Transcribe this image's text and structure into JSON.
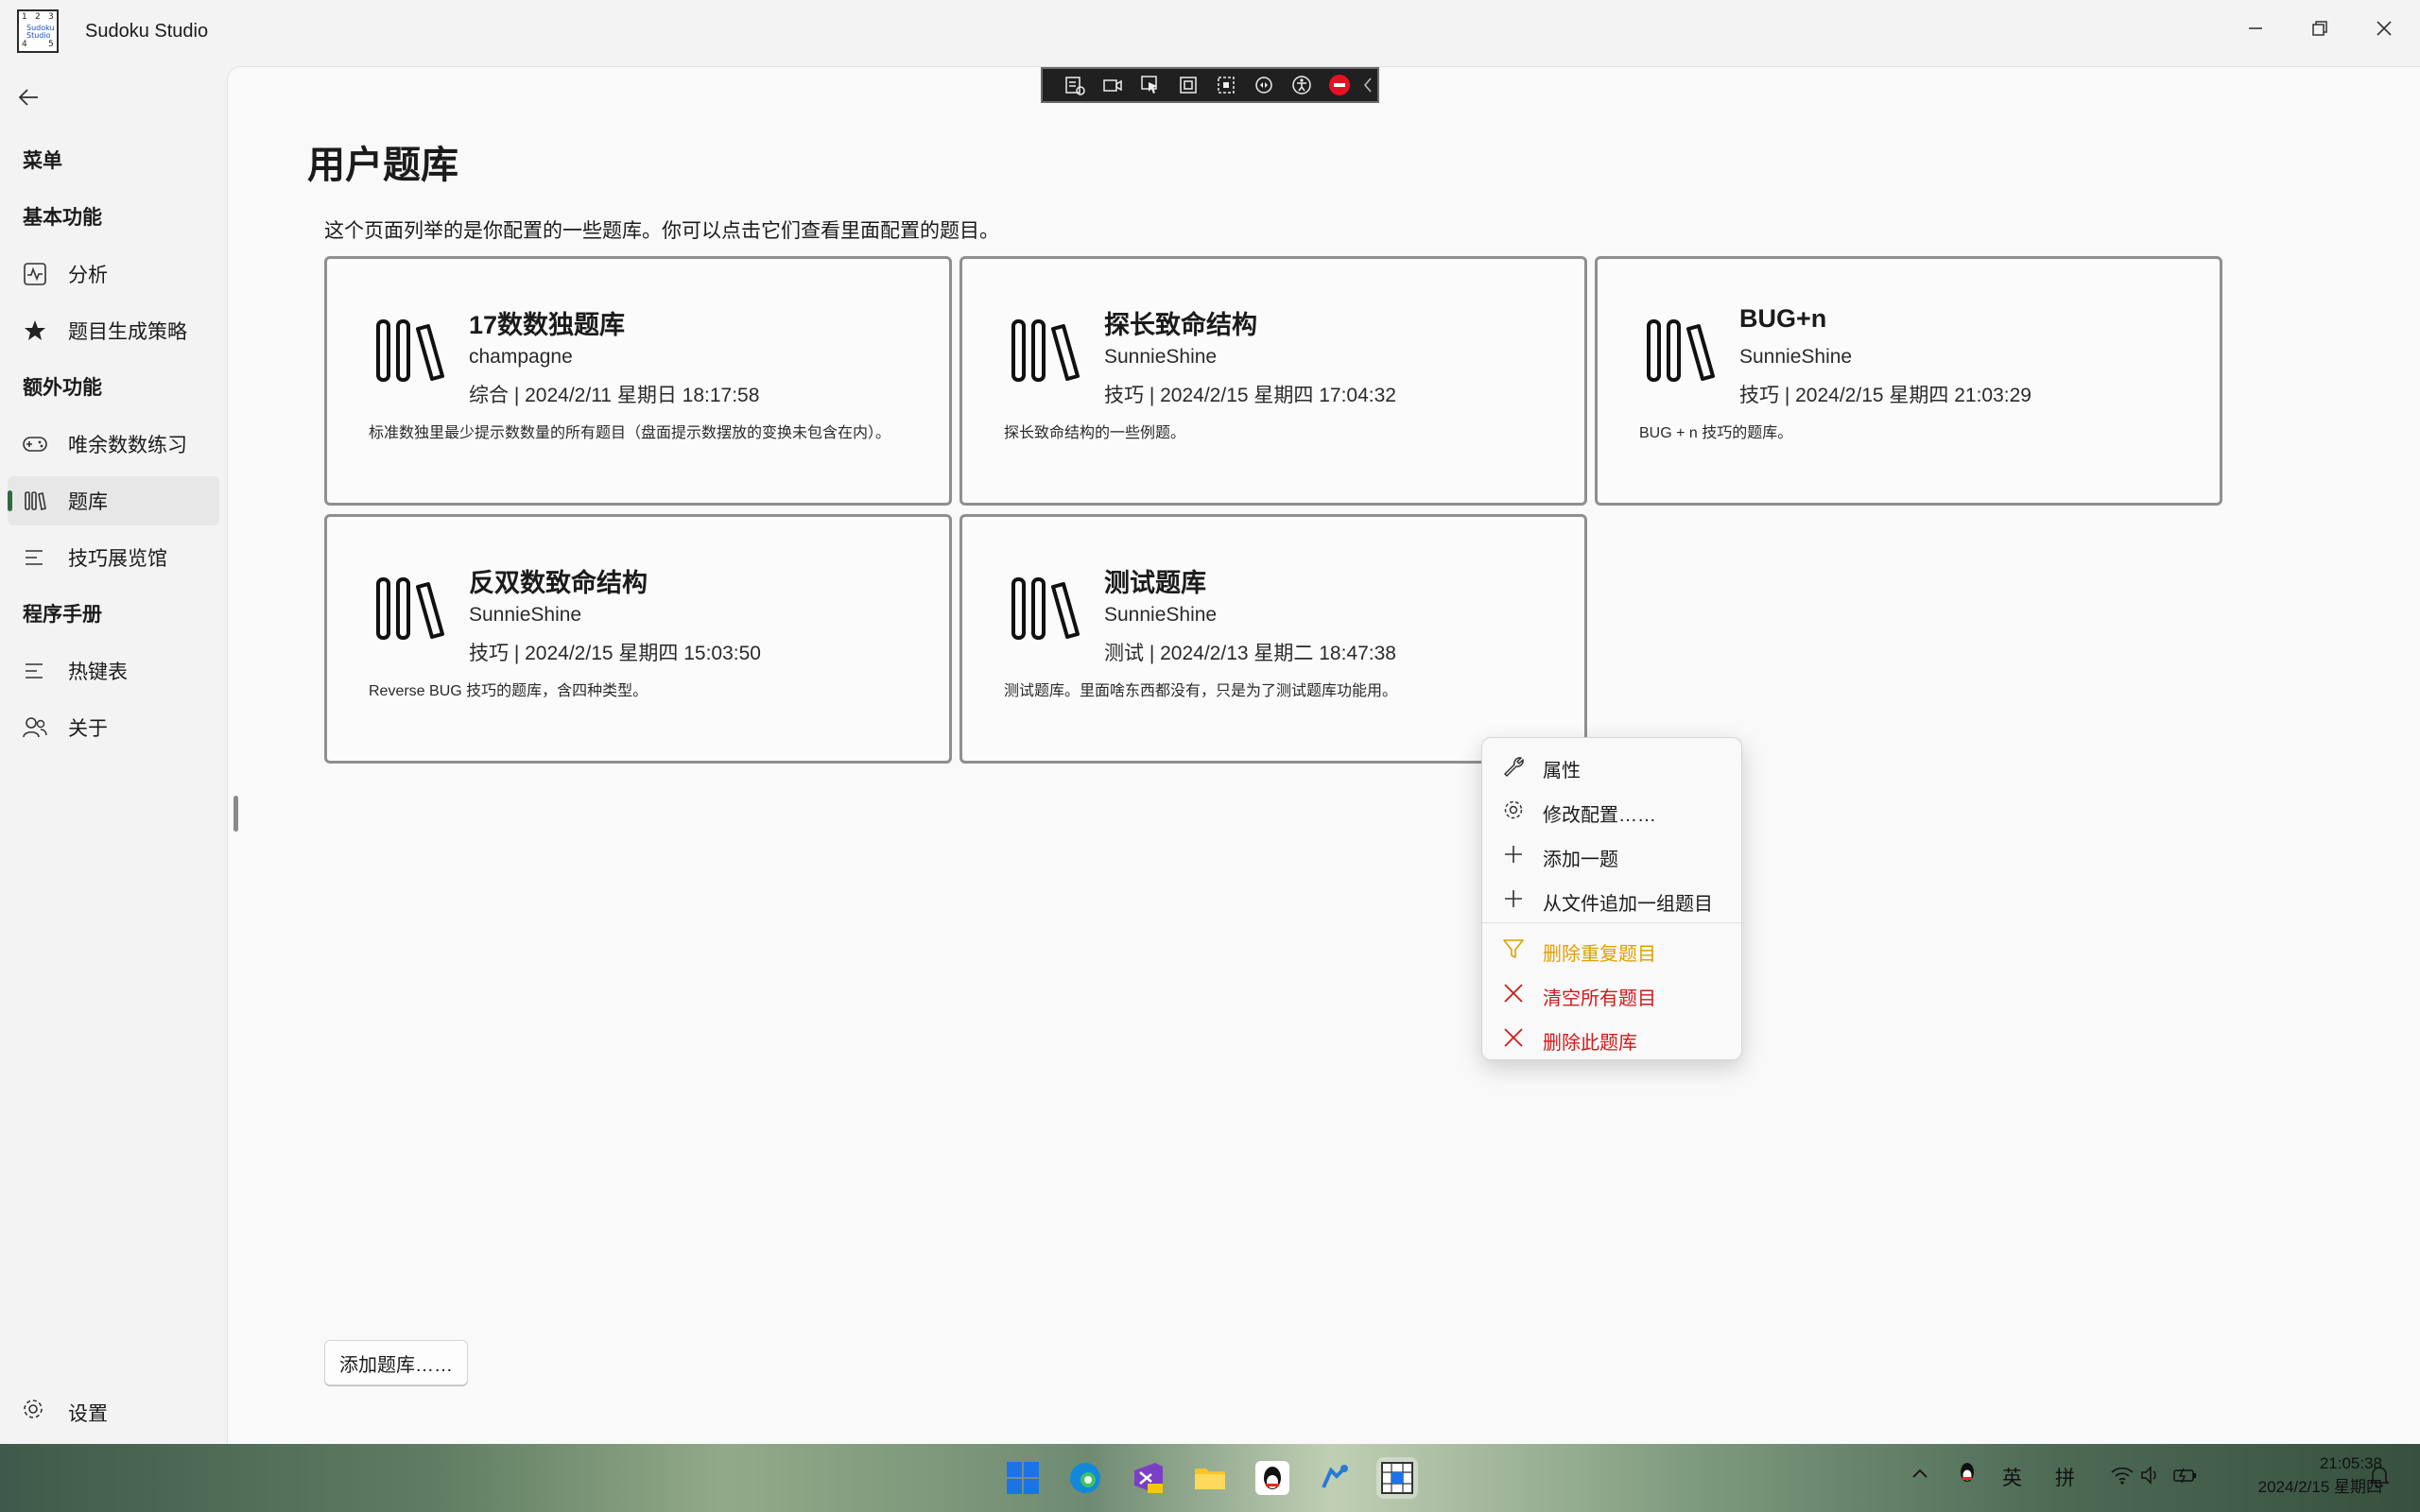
{
  "app": {
    "title": "Sudoku Studio",
    "icon_digits": [
      "1",
      "2",
      "3",
      "4",
      "5"
    ],
    "icon_text": "Sudoku Studio"
  },
  "window_controls": {
    "minimize": "—",
    "restore": "❐",
    "close": "✕"
  },
  "sidebar": {
    "menu_header": "菜单",
    "groups": {
      "basic": "基本功能",
      "extra": "额外功能",
      "manual": "程序手册"
    },
    "items": {
      "analysis": "分析",
      "strategy": "题目生成策略",
      "practice": "唯余数数练习",
      "library": "题库",
      "techniques": "技巧展览馆",
      "hotkeys": "热键表",
      "about": "关于"
    },
    "settings": "设置",
    "selected": "library"
  },
  "page": {
    "title": "用户题库",
    "description": "这个页面列举的是你配置的一些题库。你可以点击它们查看里面配置的题目。",
    "add_button": "添加题库……"
  },
  "libraries": [
    {
      "title": "17数数独题库",
      "author": "champagne",
      "meta": "综合 | 2024/2/11 星期日 18:17:58",
      "description": "标准数独里最少提示数数量的所有题目（盘面提示数摆放的变换未包含在内）。"
    },
    {
      "title": "探长致命结构",
      "author": "SunnieShine",
      "meta": "技巧 | 2024/2/15 星期四 17:04:32",
      "description": "探长致命结构的一些例题。"
    },
    {
      "title": "BUG+n",
      "author": "SunnieShine",
      "meta": "技巧 | 2024/2/15 星期四 21:03:29",
      "description": "BUG + n 技巧的题库。"
    },
    {
      "title": "反双数致命结构",
      "author": "SunnieShine",
      "meta": "技巧 | 2024/2/15 星期四 15:03:50",
      "description": "Reverse BUG 技巧的题库，含四种类型。"
    },
    {
      "title": "测试题库",
      "author": "SunnieShine",
      "meta": "测试 | 2024/2/13 星期二 18:47:38",
      "description": "测试题库。里面啥东西都没有，只是为了测试题库功能用。"
    }
  ],
  "context_menu": {
    "items": [
      {
        "label": "属性",
        "icon": "wrench-icon",
        "color": "#1b1b1b"
      },
      {
        "label": "修改配置……",
        "icon": "gear-icon",
        "color": "#1b1b1b"
      },
      {
        "label": "添加一题",
        "icon": "plus-icon",
        "color": "#1b1b1b"
      },
      {
        "label": "从文件追加一组题目",
        "icon": "plus-icon",
        "color": "#1b1b1b"
      },
      {
        "label": "删除重复题目",
        "icon": "filter-icon",
        "color": "#e0a000"
      },
      {
        "label": "清空所有题目",
        "icon": "close-icon",
        "color": "#d01a1a"
      },
      {
        "label": "删除此题库",
        "icon": "close-icon",
        "color": "#d01a1a"
      }
    ]
  },
  "taskbar": {
    "apps": [
      "start-icon",
      "edge-icon",
      "visual-studio-icon",
      "file-explorer-icon",
      "qq-icon",
      "git-icon",
      "sudoku-studio-icon"
    ],
    "tray": {
      "ime_lang": "英",
      "ime_mode": "拼"
    },
    "clock": {
      "time": "21:05:38",
      "date": "2024/2/15 星期四"
    }
  }
}
